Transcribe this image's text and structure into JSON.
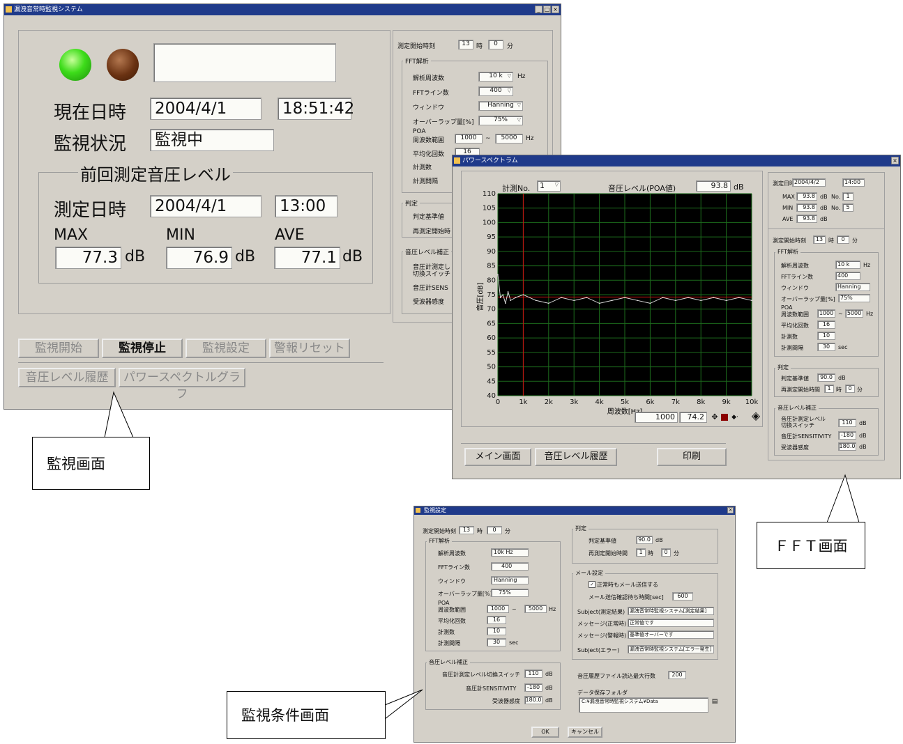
{
  "monitor": {
    "title": "漏洩音常時監視システム",
    "datetime_label": "現在日時",
    "date": "2004/4/1",
    "time": "18:51:42",
    "status_label": "監視状況",
    "status": "監視中",
    "prev_group": "前回測定音圧レベル",
    "meas_label": "測定日時",
    "meas_date": "2004/4/1",
    "meas_time": "13:00",
    "max_label": "MAX",
    "min_label": "MIN",
    "ave_label": "AVE",
    "max": "77.3",
    "min": "76.9",
    "ave": "77.1",
    "unit_db": "dB",
    "buttons": [
      "監視開始",
      "監視停止",
      "監視設定",
      "警報リセット"
    ],
    "buttons2": [
      "音圧レベル履歴",
      "パワースペクトルグラフ"
    ],
    "right": {
      "start_label": "測定開始時刻",
      "hour": "13",
      "hour_unit": "時",
      "minute": "0",
      "minute_unit": "分",
      "fft_group": "FFT解析",
      "freq_label": "解析周波数",
      "freq": "10 k",
      "hz": "Hz",
      "lines_label": "FFTライン数",
      "lines": "400",
      "window_label": "ウィンドウ",
      "window": "Hanning",
      "overlap_label": "オーバーラップ量[%]",
      "overlap": "75%",
      "poa_label1": "POA",
      "poa_label2": "周波数範囲",
      "poa_from": "1000",
      "tilde": "~",
      "poa_to": "5000",
      "avg_label": "平均化回数",
      "avg": "16",
      "count_label": "計測数",
      "interval_label": "計測間隔",
      "judge_group": "判定",
      "judge_label": "判定基準値",
      "rejudge_label": "再測定開始時",
      "level_group": "音圧レベル補正",
      "level1": "音圧計測定し",
      "level2": "切換スイッチ",
      "sensit_label": "音圧計SENS",
      "recv_label": "受波器感度"
    }
  },
  "fft": {
    "title": "パワースペクトラム",
    "no_label": "計測No.",
    "no": "1",
    "level_label": "音圧レベル(POA値)",
    "level": "93.8",
    "unit": "dB",
    "ylabel": "音圧[dB]",
    "xlabel": "周波数[Hz]",
    "cursor_x": "1000",
    "cursor_y": "74.2",
    "buttons": [
      "メイン画面",
      "音圧レベル履歴",
      "印刷"
    ],
    "right": {
      "date_label": "測定日時",
      "date": "2004/4/2",
      "time": "14:00",
      "max_label": "MAX",
      "max": "93.8",
      "max_no": "1",
      "min_label": "MIN",
      "min": "93.8",
      "min_no": "5",
      "ave_label": "AVE",
      "ave": "93.8",
      "db": "dB",
      "no": "No.",
      "start_label": "測定開始時刻",
      "hour": "13",
      "hour_unit": "時",
      "minute": "0",
      "minute_unit": "分",
      "fft_group": "FFT解析",
      "freq_label": "解析周波数",
      "freq": "10 k",
      "hz": "Hz",
      "lines_label": "FFTライン数",
      "lines": "400",
      "window_label": "ウィンドウ",
      "window": "Hanning",
      "overlap_label": "オーバーラップ量[%]",
      "overlap": "75%",
      "poa_label1": "POA",
      "poa_label2": "周波数範囲",
      "poa_from": "1000",
      "tilde": "~",
      "poa_to": "5000",
      "avg_label": "平均化回数",
      "avg": "16",
      "count_label": "計測数",
      "count": "10",
      "interval_label": "計測間隔",
      "interval": "30",
      "sec": "sec",
      "judge_group": "判定",
      "judge_label": "判定基準値",
      "judge": "90.0",
      "judge_unit": "dB",
      "rejudge_label": "再測定開始時間",
      "rejudge_h": "1",
      "rejudge_m": "0",
      "level_group": "音圧レベル補正",
      "level1": "音圧計測定レベル",
      "level2": "切換スイッチ",
      "level": "110",
      "sensit_label": "音圧計SENSITIVITY",
      "sensit": "-180",
      "recv_label": "受波器感度",
      "recv": "180.0"
    }
  },
  "chart_data": {
    "type": "line",
    "xlabel": "周波数[Hz]",
    "ylabel": "音圧[dB]",
    "xlim": [
      0,
      10000
    ],
    "ylim": [
      40,
      110
    ],
    "x_ticks": [
      "0",
      "1k",
      "2k",
      "3k",
      "4k",
      "5k",
      "6k",
      "7k",
      "8k",
      "9k",
      "10k"
    ],
    "y_ticks": [
      "40",
      "45",
      "50",
      "55",
      "60",
      "65",
      "70",
      "75",
      "80",
      "85",
      "90",
      "95",
      "100",
      "105",
      "110"
    ],
    "x": [
      0,
      100,
      200,
      300,
      400,
      500,
      700,
      1000,
      1500,
      2000,
      2500,
      3000,
      3500,
      4000,
      4500,
      5000,
      5500,
      6000,
      6500,
      7000,
      7500,
      8000,
      8500,
      9000,
      9500,
      10000
    ],
    "values": [
      82,
      74,
      75,
      72,
      76,
      73,
      74,
      75,
      73,
      72,
      74,
      73,
      74,
      72,
      73,
      74,
      73,
      72,
      74,
      73,
      74,
      73,
      74,
      73,
      74,
      73
    ],
    "reference_y": 74.2,
    "cursor_x": 1000,
    "grid": true
  },
  "settings": {
    "title": "監視設定",
    "start_label": "測定開始時刻",
    "hour": "13",
    "hour_unit": "時",
    "minute": "0",
    "minute_unit": "分",
    "fft_group": "FFT解析",
    "freq_label": "解析周波数",
    "freq": "10k Hz",
    "lines_label": "FFTライン数",
    "lines": "400",
    "window_label": "ウィンドウ",
    "window": "Hanning",
    "overlap_label": "オーバーラップ量[%]",
    "overlap": "75%",
    "poa_label1": "POA",
    "poa_label2": "周波数範囲",
    "poa_from": "1000",
    "tilde": "~",
    "poa_to": "5000",
    "hz": "Hz",
    "avg_label": "平均化回数",
    "avg": "16",
    "count_label": "計測数",
    "count": "10",
    "interval_label": "計測間隔",
    "interval": "30",
    "sec": "sec",
    "level_group": "音圧レベル補正",
    "level_label": "音圧計測定レベル切換スイッチ",
    "level": "110",
    "sensit_label": "音圧計SENSITIVITY",
    "sensit": "-180",
    "recv_label": "受波器感度",
    "recv": "180.0",
    "db": "dB",
    "judge_group": "判定",
    "judge_label": "判定基準値",
    "judge": "90.0",
    "rejudge_label": "再測定開始時間",
    "rejudge_h": "1",
    "rejudge_m": "0",
    "mail_group": "メール設定",
    "mail_check": "正常時もメール送信する",
    "mail_wait_label": "メール送信確認待ち時間[sec]",
    "mail_wait": "600",
    "subj_result_label": "Subject(測定結果)",
    "subj_result": "漏洩音常時監視システム[測定結果]",
    "msg_normal_label": "メッセージ(正常時)",
    "msg_normal": "正常値です",
    "msg_alarm_label": "メッセージ(警報時)",
    "msg_alarm": "基準値オーバーです",
    "subj_error_label": "Subject(エラー)",
    "subj_error": "漏洩音常時監視システム[エラー発生]",
    "history_label": "音圧履歴ファイル読込最大行数",
    "history": "200",
    "folder_label": "データ保存フォルダ",
    "folder": "C:¥漏洩音常時監視システム¥Data",
    "ok": "OK",
    "cancel": "キャンセル"
  },
  "callouts": {
    "monitor": "監視画面",
    "fft": "ＦＦＴ画面",
    "settings": "監視条件画面"
  }
}
